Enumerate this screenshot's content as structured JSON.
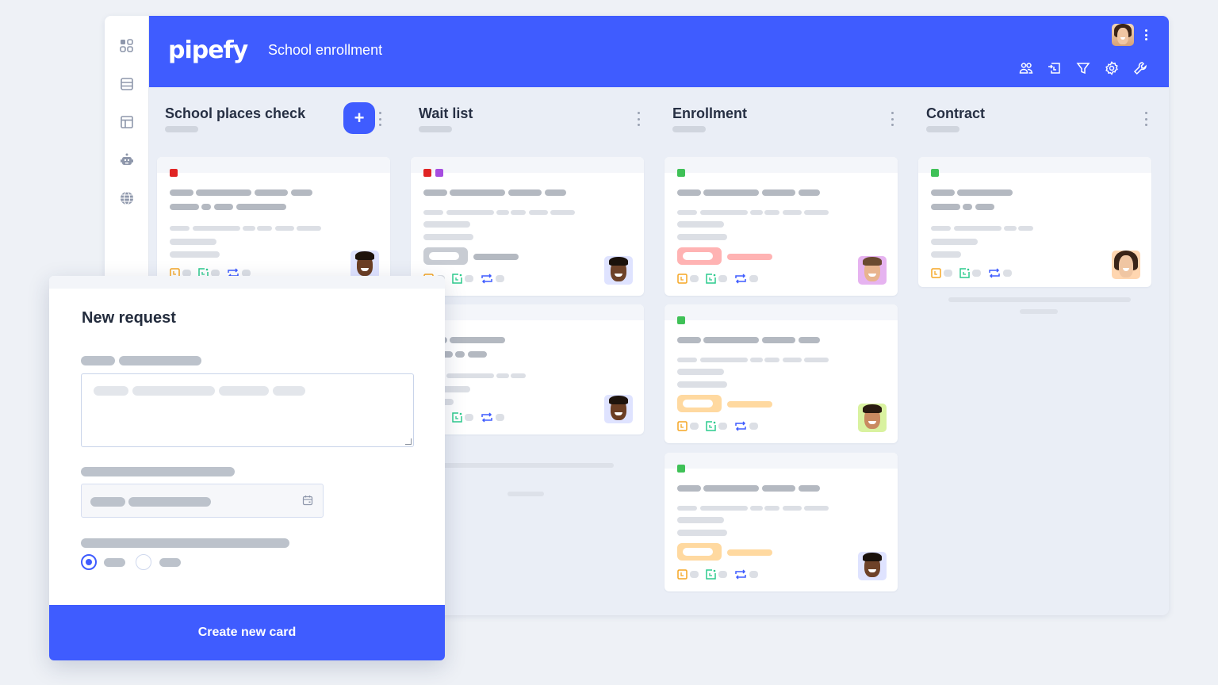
{
  "app": {
    "logo_text": "pipefy",
    "pipe_title": "School enrollment",
    "brand_color": "#3f5cff"
  },
  "sidebar": {
    "items": [
      {
        "icon": "grid-icon"
      },
      {
        "icon": "database-icon"
      },
      {
        "icon": "layout-icon"
      },
      {
        "icon": "robot-icon"
      },
      {
        "icon": "globe-icon"
      }
    ]
  },
  "header": {
    "tools": [
      "members-icon",
      "import-icon",
      "filter-icon",
      "settings-icon",
      "wrench-icon"
    ]
  },
  "phases": [
    {
      "title": "School places check",
      "has_add_button": true,
      "add_label": "+"
    },
    {
      "title": "Wait list"
    },
    {
      "title": "Enrollment"
    },
    {
      "title": "Contract"
    }
  ],
  "label_colors": {
    "red": "#e02424",
    "purple": "#a64de0",
    "green": "#3fc157"
  },
  "status_colors": {
    "neutral": "#c8ccd3",
    "red": "#ffb3b3",
    "orange": "#ffd9a0"
  },
  "modal": {
    "title": "New request",
    "submit_label": "Create new card",
    "radio_selected": 0
  }
}
